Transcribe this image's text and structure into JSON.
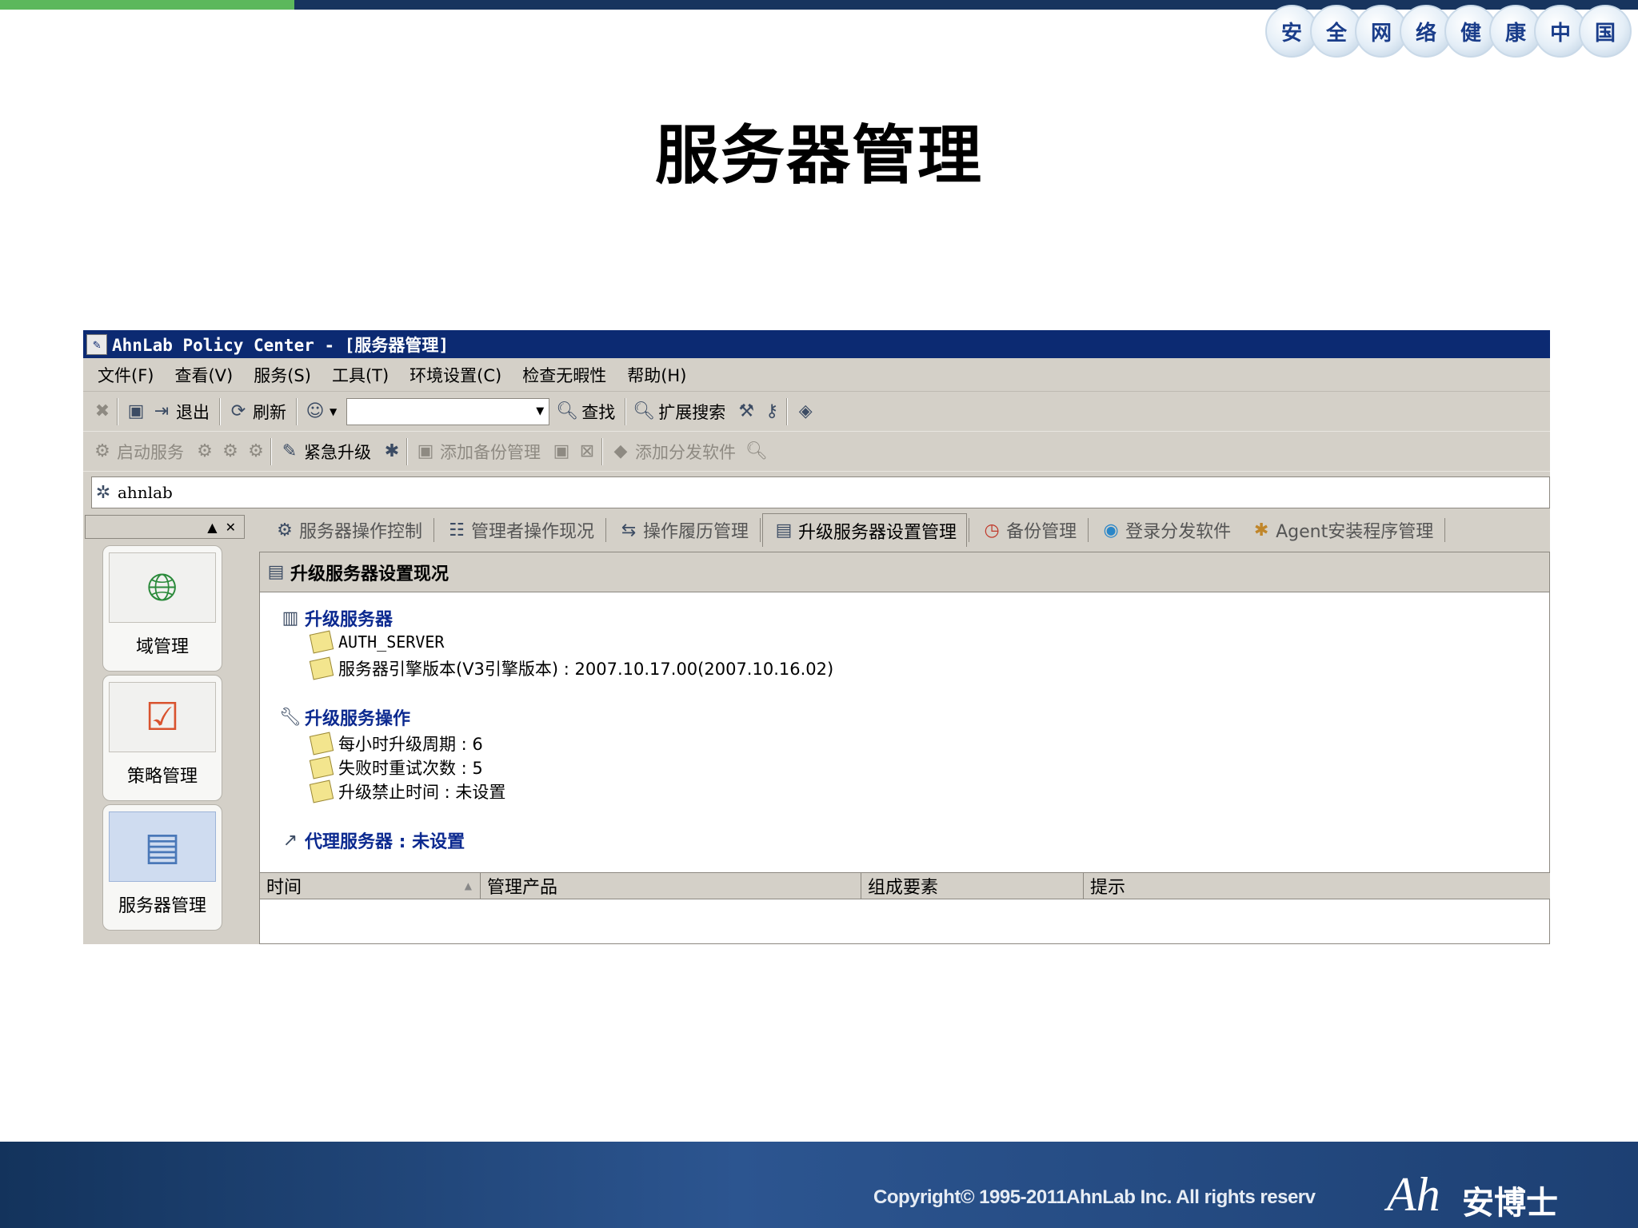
{
  "slide": {
    "badges": [
      "安",
      "全",
      "网",
      "络",
      "健",
      "康",
      "中",
      "国"
    ],
    "title": "服务器管理",
    "footer_copyright": "Copyright© 1995-2011AhnLab Inc. All rights reserv",
    "footer_logo": "Ah",
    "footer_brand": "安博士",
    "colors": {
      "top_bar": "#17345e",
      "top_accent": "#5cb85c",
      "footer": "#1d4073"
    }
  },
  "window": {
    "title": "AhnLab Policy Center - [服务器管理]",
    "menu": [
      "文件(F)",
      "查看(V)",
      "服务(S)",
      "工具(T)",
      "环境设置(C)",
      "检查无暇性",
      "帮助(H)"
    ],
    "toolbar1": {
      "exit_label": "退出",
      "refresh_label": "刷新",
      "find_label": "查找",
      "ext_search_label": "扩展搜索"
    },
    "toolbar2": {
      "start_service_label": "启动服务",
      "emergency_upgrade_label": "紧急升级",
      "add_backup_label": "添加备份管理",
      "add_dist_label": "添加分发软件"
    },
    "address_value": "ahnlab"
  },
  "leftpane": {
    "nav": [
      {
        "label": "域管理",
        "icon": "www-globe-icon"
      },
      {
        "label": "策略管理",
        "icon": "policy-icon"
      },
      {
        "label": "服务器管理",
        "icon": "server-icon"
      }
    ]
  },
  "tabs": [
    "服务器操作控制",
    "管理者操作现况",
    "操作履历管理",
    "升级服务器设置管理",
    "备份管理",
    "登录分发软件",
    "Agent安装程序管理"
  ],
  "content": {
    "header": "升级服务器设置现况",
    "upgrade_server": {
      "title": "升级服务器",
      "name": "AUTH_SERVER",
      "engine_version": "服务器引擎版本(V3引擎版本) : 2007.10.17.00(2007.10.16.02)"
    },
    "upgrade_ops": {
      "title": "升级服务操作",
      "period": "每小时升级周期 : 6",
      "retry": "失败时重试次数 : 5",
      "forbid": "升级禁止时间 : 未设置"
    },
    "proxy": {
      "title": "代理服务器 : 未设置"
    },
    "grid_columns": [
      "时间",
      "管理产品",
      "组成要素",
      "提示"
    ]
  }
}
